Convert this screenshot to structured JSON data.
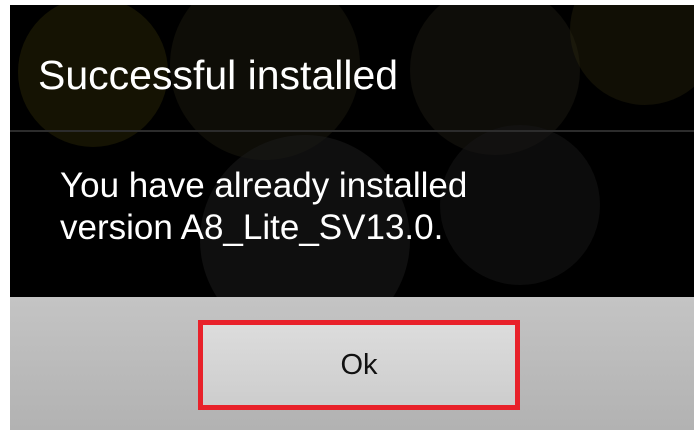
{
  "dialog": {
    "title": "Successful installed",
    "message_line1": "You have already installed",
    "message_line2": "version A8_Lite_SV13.0.",
    "ok_label": "Ok"
  },
  "colors": {
    "dialog_background": "#000000",
    "button_bar": "#bdbdbd",
    "highlight_border": "#e8212a",
    "text_primary": "#ffffff"
  }
}
